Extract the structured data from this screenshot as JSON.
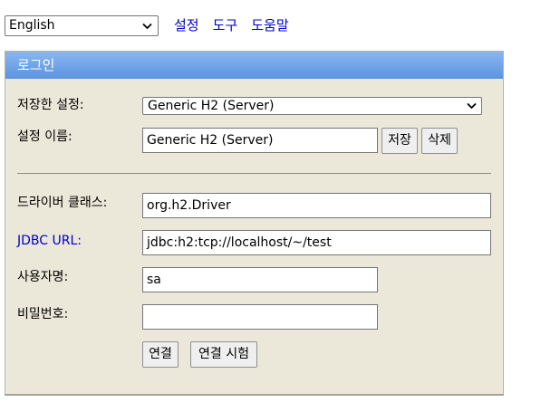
{
  "topbar": {
    "language": "English",
    "links": [
      "설정",
      "도구",
      "도움말"
    ]
  },
  "login": {
    "title": "로그인",
    "saved_settings_label": "저장한 설정:",
    "saved_settings_value": "Generic H2 (Server)",
    "setting_name_label": "설정 이름:",
    "setting_name_value": "Generic H2 (Server)",
    "save_button": "저장",
    "delete_button": "삭제",
    "driver_class_label": "드라이버 클래스:",
    "driver_class_value": "org.h2.Driver",
    "jdbc_url_label": "JDBC URL:",
    "jdbc_url_value": "jdbc:h2:tcp://localhost/~/test",
    "username_label": "사용자명:",
    "username_value": "sa",
    "password_label": "비밀번호:",
    "password_value": "",
    "connect_button": "연결",
    "test_connection_button": "연결 시험"
  },
  "colors": {
    "panel_bg": "#ebe7d9",
    "header_bg": "#6ca0e6",
    "link": "#0000cc"
  }
}
